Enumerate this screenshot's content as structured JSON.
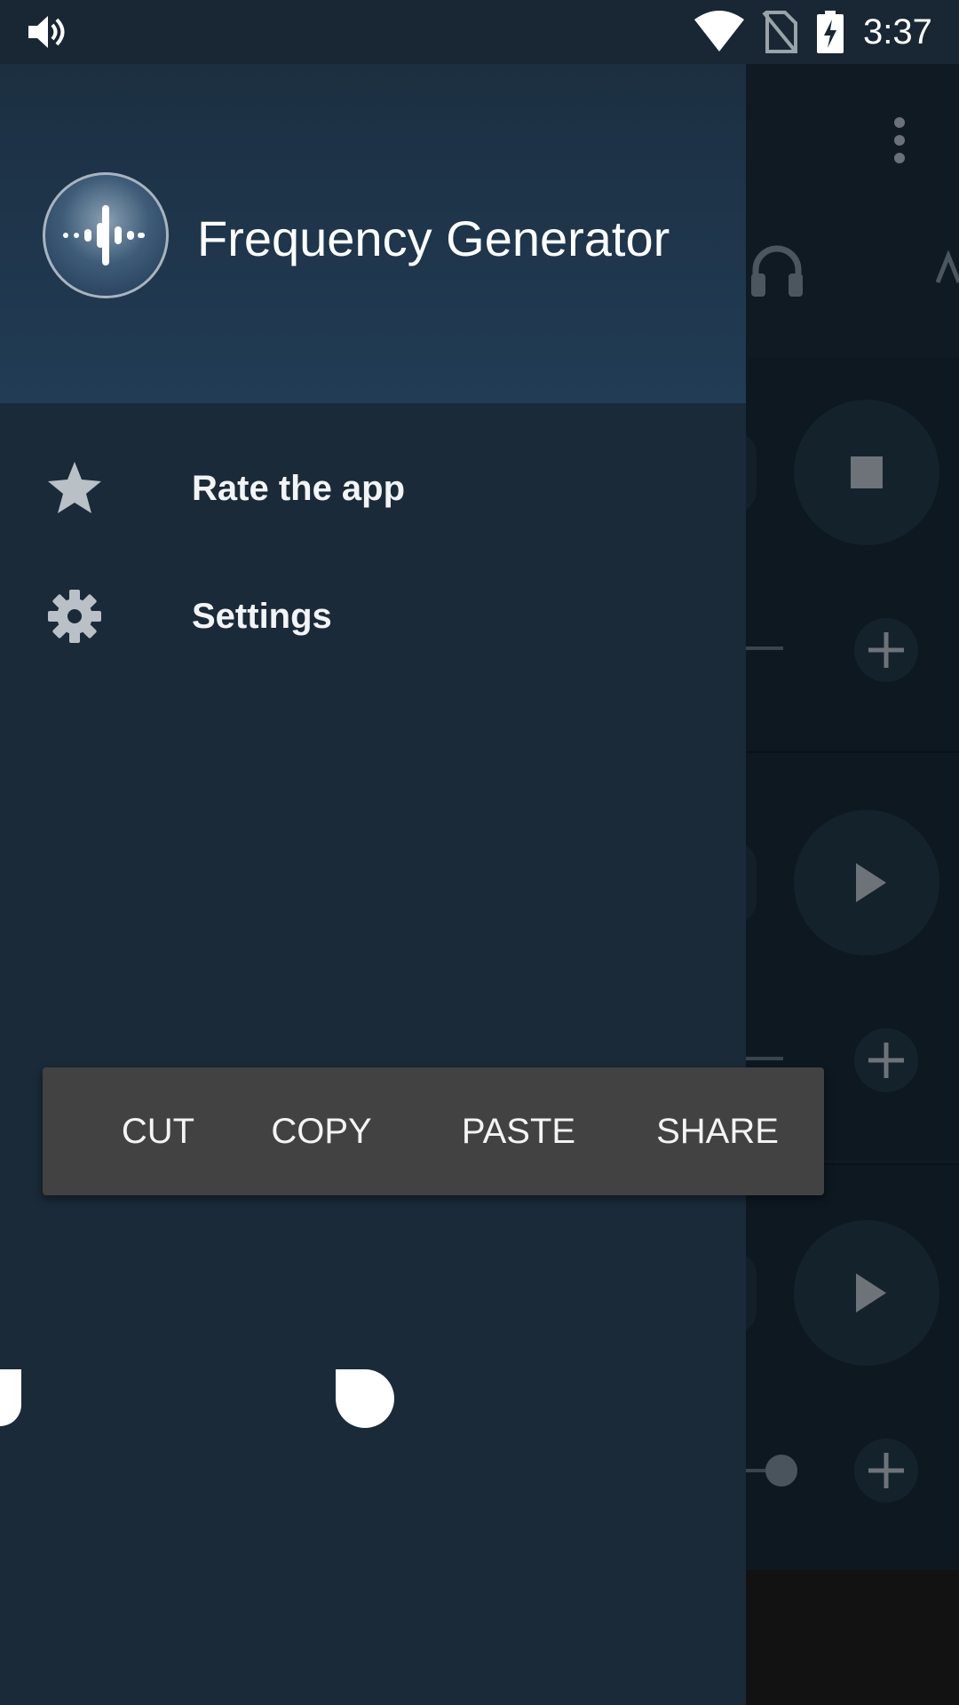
{
  "status_bar": {
    "time": "3:37",
    "icons": [
      "volume-icon",
      "wifi-icon",
      "no-sim-icon",
      "battery-charging-icon"
    ]
  },
  "drawer": {
    "app_title": "Frequency Generator",
    "logo_icon": "sound-wave-icon",
    "items": [
      {
        "label": "Rate the app",
        "icon": "star-icon"
      },
      {
        "label": "Settings",
        "icon": "gear-icon"
      }
    ]
  },
  "text_toolbar": {
    "cut": "CUT",
    "copy": "COPY",
    "paste": "PASTE",
    "share": "SHARE"
  },
  "background_app": {
    "icons": [
      "more-vert-icon",
      "headphones-icon",
      "waveform-icon",
      "stop-icon",
      "play-icon",
      "play-icon",
      "plus-icon",
      "plus-icon",
      "plus-icon"
    ]
  },
  "colors": {
    "status_bar": "#182733",
    "drawer": "#1a2a38",
    "drawer_header": "#213c55",
    "toolbar": "#424242"
  }
}
